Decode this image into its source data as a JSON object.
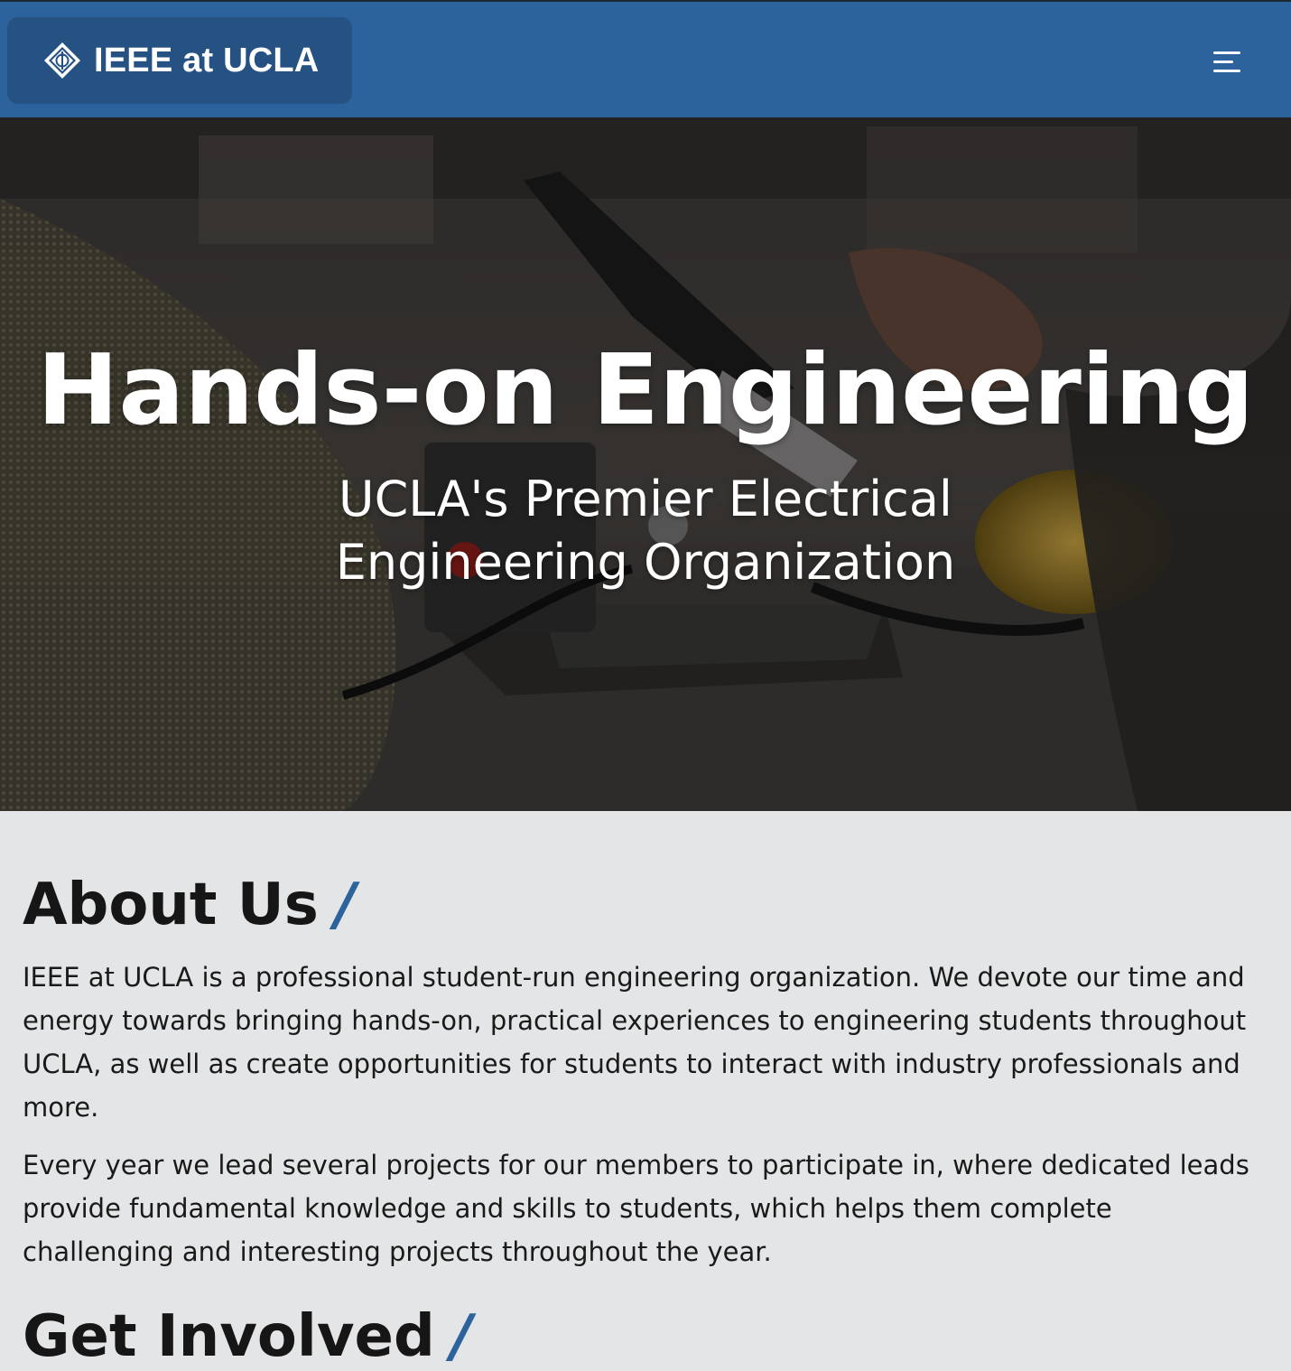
{
  "navbar": {
    "brand_text": "IEEE at UCLA",
    "brand_icon": "ieee-diamond-logo",
    "menu_icon": "hamburger-menu-icon",
    "background_color": "#2d639c"
  },
  "hero": {
    "title": "Hands-on Engineering",
    "subtitle": "UCLA's Premier Electrical Engineering Organization",
    "background_image": "soldering-station-photo"
  },
  "about": {
    "heading": "About Us",
    "slash": "/",
    "paragraphs": [
      "IEEE at UCLA is a professional student-run engineering organization. We devote our time and energy towards bringing hands-on, practical experiences to engineering students throughout UCLA, as well as create opportunities for students to interact with industry professionals and more.",
      "Every year we lead several projects for our members to participate in, where dedicated leads provide fundamental knowledge and skills to students, which helps them complete challenging and interesting projects throughout the year."
    ]
  },
  "get_involved": {
    "heading": "Get Involved",
    "slash": "/"
  },
  "colors": {
    "accent": "#2d639c",
    "brand_box": "#255283",
    "page_background": "#e4e5e6",
    "text": "#161616"
  }
}
